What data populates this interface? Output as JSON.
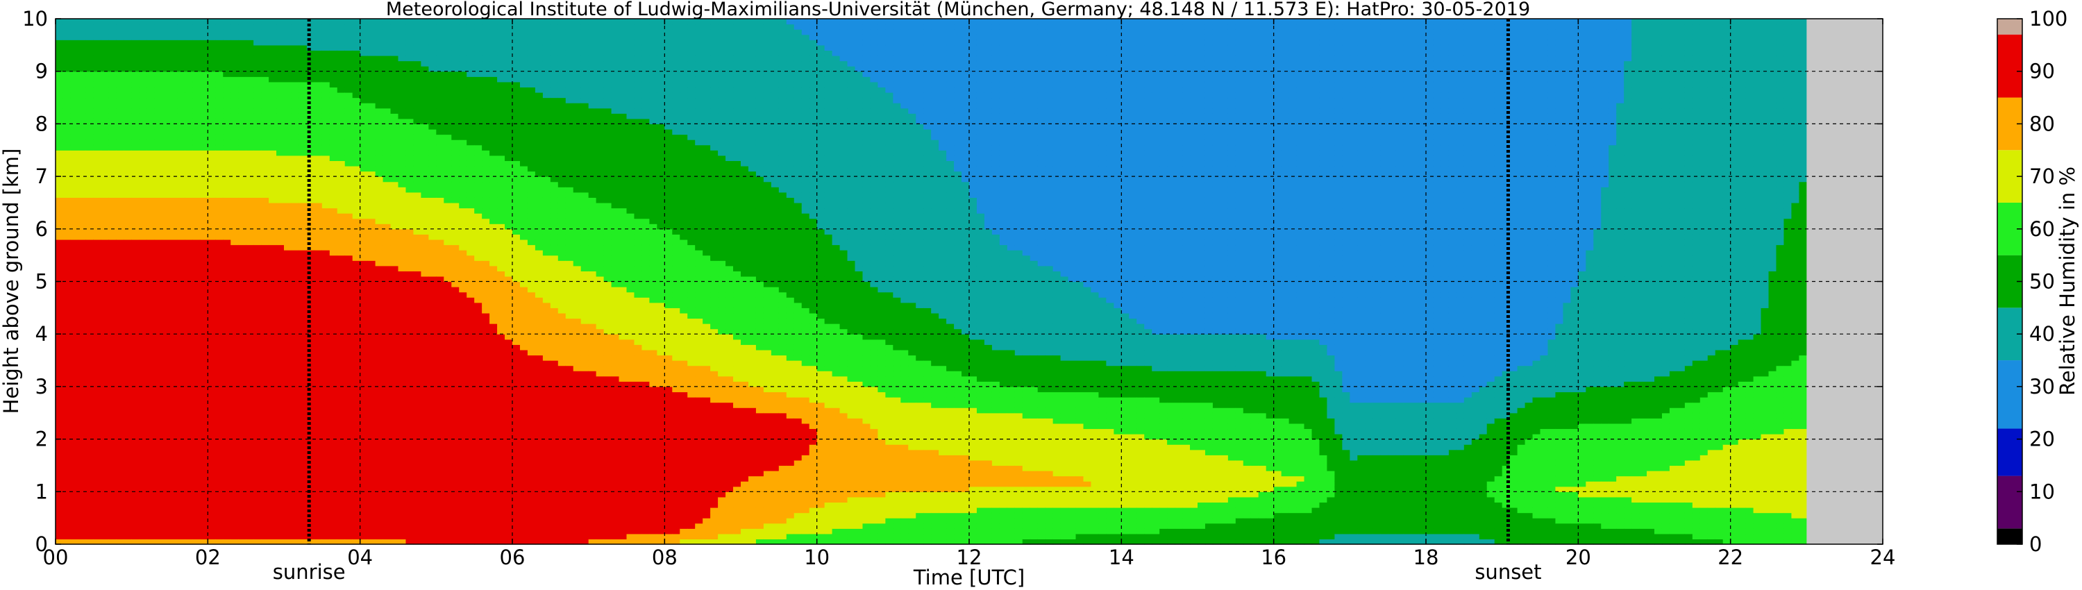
{
  "chart_data": {
    "type": "heatmap",
    "title": "Meteorological Institute of Ludwig-Maximilians-Universität (München, Germany; 48.148 N / 11.573 E):    HatPro: 30-05-2019",
    "xlabel": "Time [UTC]",
    "ylabel": "Height above ground [km]",
    "xlim": [
      0,
      24
    ],
    "ylim": [
      0,
      10
    ],
    "x_ticks": [
      "00",
      "02",
      "04",
      "06",
      "08",
      "10",
      "12",
      "14",
      "16",
      "18",
      "20",
      "22",
      "24"
    ],
    "y_ticks": [
      "0",
      "1",
      "2",
      "3",
      "4",
      "5",
      "6",
      "7",
      "8",
      "9",
      "10"
    ],
    "grid": true,
    "data_end_time": 23.0,
    "colorbar": {
      "label": "Relative Humidity in %",
      "ticks": [
        "0",
        "10",
        "20",
        "30",
        "40",
        "50",
        "60",
        "70",
        "80",
        "90",
        "100"
      ],
      "colors": [
        {
          "from": 0,
          "to": 3,
          "color": "#000000"
        },
        {
          "from": 3,
          "to": 13,
          "color": "#5a0064"
        },
        {
          "from": 13,
          "to": 22,
          "color": "#0010c8"
        },
        {
          "from": 22,
          "to": 35,
          "color": "#1a8ee0"
        },
        {
          "from": 35,
          "to": 45,
          "color": "#0aa8a0"
        },
        {
          "from": 45,
          "to": 55,
          "color": "#00a800"
        },
        {
          "from": 55,
          "to": 65,
          "color": "#22ee22"
        },
        {
          "from": 65,
          "to": 75,
          "color": "#d8ee00"
        },
        {
          "from": 75,
          "to": 85,
          "color": "#ffaa00"
        },
        {
          "from": 85,
          "to": 97,
          "color": "#e80000"
        },
        {
          "from": 97,
          "to": 100,
          "color": "#c8a898"
        }
      ]
    },
    "markers": [
      {
        "label": "sunrise",
        "time": 3.33
      },
      {
        "label": "sunset",
        "time": 19.08
      }
    ],
    "profiles": [
      {
        "t": 0.0,
        "h": [
          0,
          0.3,
          5.2,
          6.2,
          7.5,
          9.0,
          9.6,
          10
        ],
        "rh": [
          80,
          92,
          92,
          80,
          65,
          55,
          45,
          40
        ]
      },
      {
        "t": 2.0,
        "h": [
          0,
          0.3,
          5.2,
          6.2,
          7.5,
          9.0,
          9.6,
          10
        ],
        "rh": [
          82,
          92,
          92,
          80,
          65,
          55,
          45,
          40
        ]
      },
      {
        "t": 3.5,
        "h": [
          0,
          0.3,
          5.0,
          6.0,
          7.4,
          8.8,
          9.4,
          10
        ],
        "rh": [
          80,
          92,
          92,
          80,
          65,
          55,
          45,
          40
        ]
      },
      {
        "t": 5.0,
        "h": [
          0,
          0.3,
          4.6,
          5.6,
          6.8,
          8.3,
          9.0,
          10
        ],
        "rh": [
          85,
          92,
          92,
          78,
          62,
          52,
          45,
          40
        ]
      },
      {
        "t": 6.5,
        "h": [
          0,
          0.3,
          3.0,
          4.5,
          6.0,
          7.5,
          8.5,
          10
        ],
        "rh": [
          88,
          92,
          90,
          75,
          60,
          52,
          45,
          40
        ]
      },
      {
        "t": 8.0,
        "h": [
          0,
          0.3,
          2.6,
          3.6,
          5.0,
          7.0,
          8.5,
          10
        ],
        "rh": [
          75,
          90,
          92,
          75,
          60,
          50,
          42,
          38
        ]
      },
      {
        "t": 9.5,
        "h": [
          0,
          0.4,
          2.2,
          3.0,
          4.0,
          6.0,
          8.0,
          10
        ],
        "rh": [
          60,
          75,
          92,
          72,
          60,
          48,
          40,
          35
        ]
      },
      {
        "t": 11.0,
        "h": [
          0,
          0.5,
          1.3,
          2.5,
          3.5,
          5.0,
          7.0,
          10
        ],
        "rh": [
          55,
          65,
          82,
          68,
          58,
          42,
          38,
          32
        ]
      },
      {
        "t": 12.5,
        "h": [
          0,
          0.5,
          1.2,
          2.5,
          3.0,
          4.0,
          6.0,
          10
        ],
        "rh": [
          55,
          60,
          78,
          65,
          55,
          40,
          34,
          30
        ]
      },
      {
        "t": 14.5,
        "h": [
          0,
          0.5,
          1.0,
          2.5,
          3.0,
          4.0,
          6.0,
          10
        ],
        "rh": [
          50,
          60,
          75,
          60,
          50,
          35,
          30,
          28
        ]
      },
      {
        "t": 16.5,
        "h": [
          0,
          0.5,
          1.2,
          2.2,
          3.0,
          4.0,
          6.0,
          10
        ],
        "rh": [
          45,
          52,
          65,
          55,
          48,
          34,
          30,
          28
        ]
      },
      {
        "t": 17.0,
        "h": [
          0,
          0.5,
          1.0,
          2.1,
          2.8,
          3.5,
          6.0,
          10
        ],
        "rh": [
          42,
          48,
          52,
          40,
          34,
          30,
          28,
          25
        ]
      },
      {
        "t": 18.5,
        "h": [
          0,
          0.5,
          1.0,
          2.1,
          2.8,
          3.5,
          6.0,
          10
        ],
        "rh": [
          42,
          48,
          52,
          42,
          34,
          30,
          28,
          26
        ]
      },
      {
        "t": 19.5,
        "h": [
          0,
          0.5,
          1.0,
          2.0,
          2.8,
          3.5,
          6.0,
          10
        ],
        "rh": [
          48,
          55,
          65,
          58,
          45,
          35,
          32,
          30
        ]
      },
      {
        "t": 21.0,
        "h": [
          0,
          0.5,
          1.0,
          2.0,
          2.8,
          3.5,
          6.0,
          10
        ],
        "rh": [
          50,
          60,
          68,
          60,
          50,
          40,
          38,
          36
        ]
      },
      {
        "t": 22.0,
        "h": [
          0,
          0.5,
          1.0,
          2.5,
          3.2,
          4.0,
          6.0,
          10
        ],
        "rh": [
          55,
          62,
          70,
          62,
          52,
          42,
          40,
          38
        ]
      },
      {
        "t": 23.0,
        "h": [
          0,
          0.5,
          1.0,
          3.0,
          4.0,
          5.5,
          7.0,
          10
        ],
        "rh": [
          60,
          65,
          70,
          62,
          50,
          48,
          45,
          40
        ]
      }
    ]
  }
}
